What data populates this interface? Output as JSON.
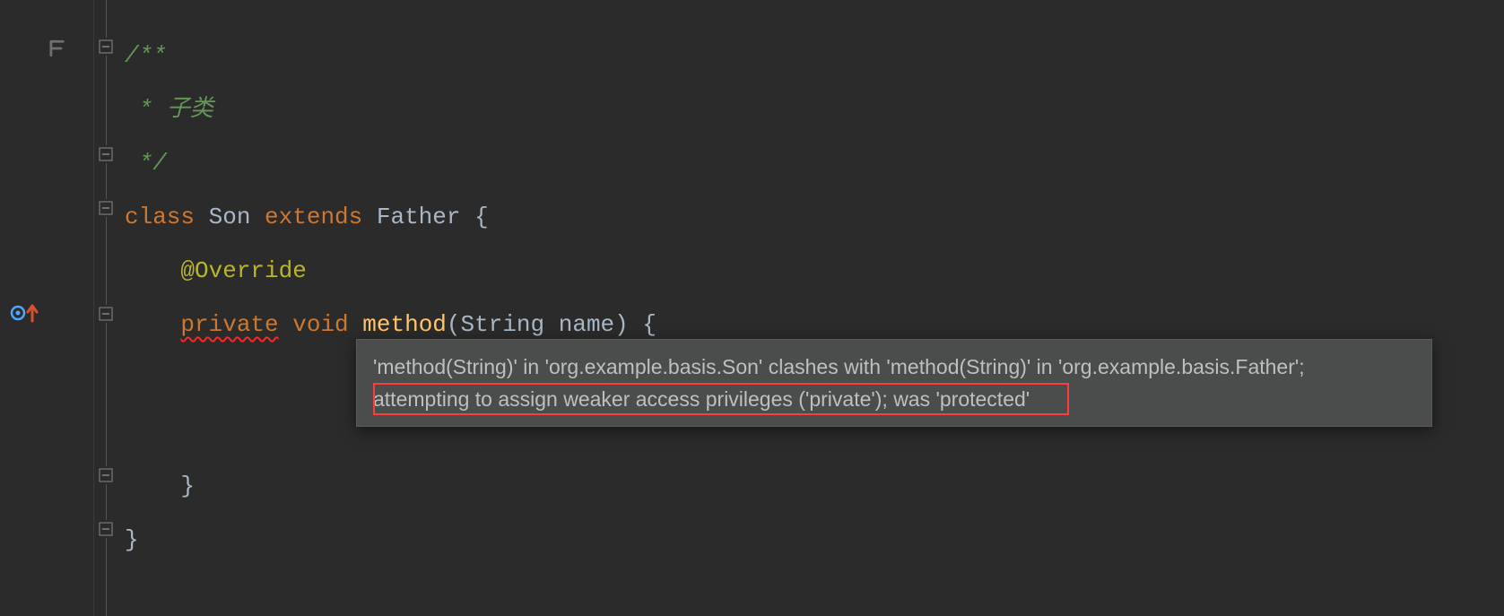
{
  "code": {
    "javadoc_open": "/**",
    "javadoc_body_prefix": " * ",
    "javadoc_body": "子类",
    "javadoc_close": " */",
    "class_kw": "class",
    "class_name": "Son",
    "extends_kw": "extends",
    "parent_name": "Father",
    "brace_open": "{",
    "annotation": "@Override",
    "modifier": "private",
    "return_type": "void",
    "method_name": "method",
    "param_type": "String",
    "param_name": "name",
    "paren_open": "(",
    "paren_close": ")",
    "method_brace_open": "{",
    "method_brace_close": "}",
    "class_brace_close": "}"
  },
  "tooltip": {
    "line1": "'method(String)' in 'org.example.basis.Son' clashes with 'method(String)' in 'org.example.basis.Father';",
    "line2": "attempting to assign weaker access privileges ('private'); was 'protected'"
  },
  "colors": {
    "bg": "#2b2b2b",
    "javadoc": "#629755",
    "keyword": "#cc7832",
    "annotation": "#bbb529",
    "methodName": "#ffc66d",
    "text": "#a9b7c6",
    "tooltipBg": "#4b4d4d",
    "tooltipText": "#bfbfbf",
    "errorRed": "#ff3b3b"
  }
}
